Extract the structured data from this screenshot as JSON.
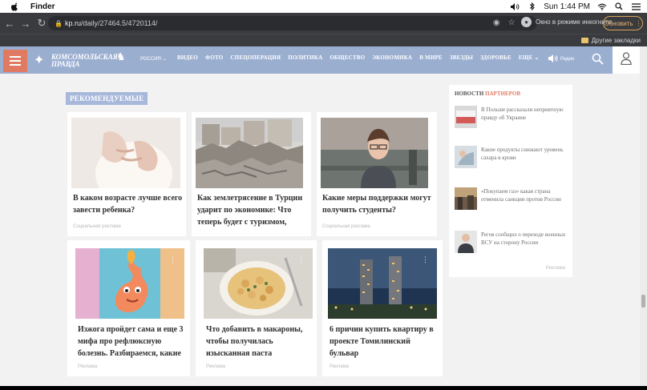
{
  "menubar": {
    "app_name": "Finder",
    "clock": "Sun 1:44 PM"
  },
  "browser": {
    "url_domain": "kp.ru",
    "url_path": "/daily/27464.5/4720114/",
    "incognito_label": "Окно в режиме инкогнито",
    "update_label": "Обновить",
    "bookmarks_label": "Другие закладки"
  },
  "site": {
    "logo_line1": "КОМСОМОЛЬСКАЯ",
    "logo_line2": "ПРАВДА",
    "region": "РОССИЯ",
    "nav": [
      "ВИДЕО",
      "ФОТО",
      "СПЕЦОПЕРАЦИЯ",
      "ПОЛИТИКА",
      "ОБЩЕСТВО",
      "ЭКОНОМИКА",
      "В МИРЕ",
      "ЗВЕЗДЫ",
      "ЗДОРОВЬЕ",
      "ЕЩЕ"
    ],
    "radio": "Радио"
  },
  "recommended": {
    "badge": "РЕКОМЕНДУЕМЫЕ",
    "cards": [
      {
        "title": "В каком возрасте лучше всего завести ребенка?",
        "source": "Социальная реклама"
      },
      {
        "title": "Как землетрясение в Турции ударит по экономике: Что теперь будет с туризмом,",
        "source": ""
      },
      {
        "title": "Какие меры поддержки могут получить студенты?",
        "source": "Социальная реклама"
      },
      {
        "title": "Изжога пройдет сама и еще 3 мифа про рефлюксную болезнь. Разбираемся, какие",
        "source": "Реклама"
      },
      {
        "title": "Что добавить в макароны, чтобы получилась изысканная паста",
        "source": "Реклама"
      },
      {
        "title": "6 причин купить квартиру в проекте Томилинский бульвар",
        "source": "Реклама"
      }
    ]
  },
  "partners": {
    "heading_part1": "НОВОСТИ",
    "heading_part2": "ПАРТНЕРОВ",
    "items": [
      {
        "text": "В Польше рассказали неприятную правду об Украине"
      },
      {
        "text": "Какие продукты снижают уровень сахара в крови"
      },
      {
        "text": "«Покупаем газ» какая страна отменила санкции против России"
      },
      {
        "text": "Регов сообщил о переходе военных ВСУ на сторону России"
      }
    ],
    "ad_label": "Реклама"
  }
}
